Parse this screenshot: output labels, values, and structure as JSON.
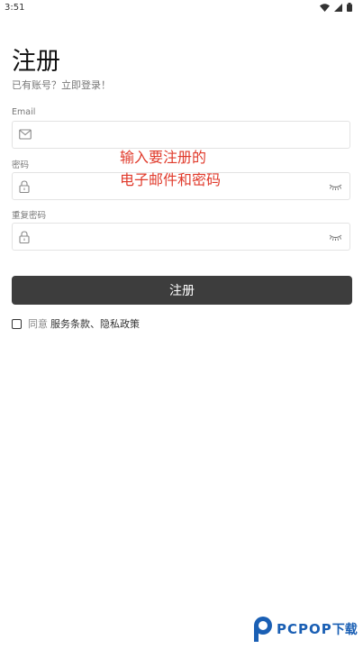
{
  "status_bar": {
    "time": "3:51"
  },
  "page": {
    "title": "注册",
    "subtitle": "已有账号？立即登录！"
  },
  "form": {
    "email": {
      "label": "Email",
      "value": ""
    },
    "password": {
      "label": "密码",
      "value": ""
    },
    "confirm_password": {
      "label": "重复密码",
      "value": ""
    },
    "submit_label": "注册"
  },
  "annotation": {
    "line1": "输入要注册的",
    "line2": "电子邮件和密码",
    "color": "#e03a2b"
  },
  "agreement": {
    "prefix": "同意",
    "terms": "服务条款、隐私政策",
    "checked": false
  },
  "watermark": {
    "brand": "PCPOP",
    "suffix": "下载",
    "color": "#1a5fb4"
  },
  "colors": {
    "button_bg": "#3d3d3d",
    "border": "#e3e3e3"
  }
}
